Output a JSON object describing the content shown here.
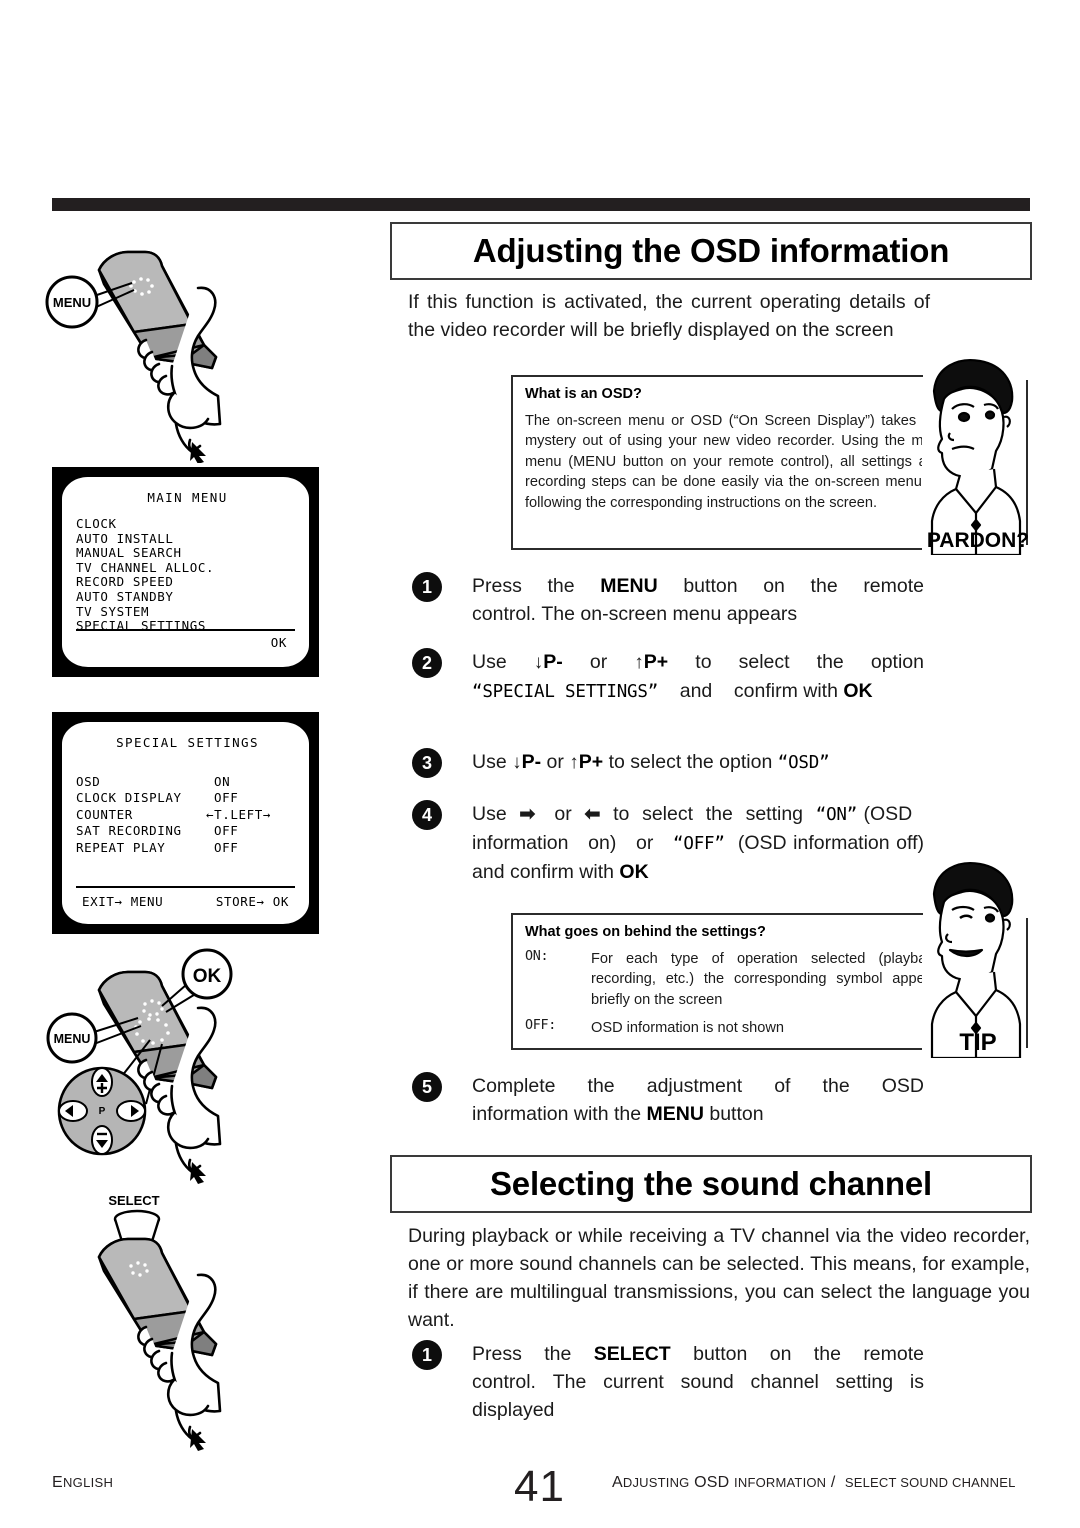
{
  "document": {
    "page_number": "41",
    "footer_left": "ENGLISH",
    "footer_right": "ADJUSTING OSD INFORMATION /  SELECT SOUND CHANNEL"
  },
  "sections": {
    "osd": {
      "title": "Adjusting the OSD information",
      "intro": "If this function is activated, the current operating details of the video recorder will be briefly displayed on the screen",
      "info_box": {
        "title": "What is an OSD?",
        "text": "The on-screen menu or OSD (“On Screen Display”) takes the mystery out of using your new video recorder. Using the main menu (MENU button on your remote control), all settings and recording steps can be done easily via the on-screen menu by following the corresponding instructions on the screen.",
        "badge": "PARDON?"
      },
      "steps": [
        {
          "num": "1",
          "parts": [
            {
              "t": "Press  the  ",
              "s": "n"
            },
            {
              "t": "MENU",
              "s": "b"
            },
            {
              "t": "  button  on  the  remote control. The on-screen menu appears",
              "s": "n"
            }
          ]
        },
        {
          "num": "2",
          "parts": [
            {
              "t": "Use  ",
              "s": "n"
            },
            {
              "t": "↓",
              "s": "arr"
            },
            {
              "t": "P-",
              "s": "b"
            },
            {
              "t": "  or  ",
              "s": "n"
            },
            {
              "t": "↑",
              "s": "arr"
            },
            {
              "t": "P+",
              "s": "b"
            },
            {
              "t": "  to  select  the  option ",
              "s": "n"
            },
            {
              "t": "“SPECIAL SETTINGS”",
              "s": "m"
            },
            {
              "t": "   and    confirm  with ",
              "s": "n"
            },
            {
              "t": "OK",
              "s": "b"
            }
          ]
        },
        {
          "num": "3",
          "parts": [
            {
              "t": "Use ",
              "s": "n"
            },
            {
              "t": "↓",
              "s": "arr"
            },
            {
              "t": "P-",
              "s": "b"
            },
            {
              "t": " or ",
              "s": "n"
            },
            {
              "t": "↑",
              "s": "arr"
            },
            {
              "t": "P+",
              "s": "b"
            },
            {
              "t": " to select the option ",
              "s": "n"
            },
            {
              "t": "“OSD”",
              "s": "m"
            }
          ]
        },
        {
          "num": "4",
          "parts": [
            {
              "t": "Use  ",
              "s": "n"
            },
            {
              "t": "➡",
              "s": "arr"
            },
            {
              "t": "   or  ",
              "s": "n"
            },
            {
              "t": "⬅",
              "s": "arr"
            },
            {
              "t": "  to  select  the  setting  ",
              "s": "n"
            },
            {
              "t": "“ON”",
              "s": "m"
            },
            {
              "t": " (OSD   information   on)   or   ",
              "s": "n"
            },
            {
              "t": "“OFF”",
              "s": "m"
            },
            {
              "t": "  (OSD information off) and confirm with ",
              "s": "n"
            },
            {
              "t": "OK",
              "s": "b"
            }
          ]
        },
        {
          "num": "5",
          "parts": [
            {
              "t": "Complete   the   adjustment   of   the   OSD information with the ",
              "s": "n"
            },
            {
              "t": "MENU",
              "s": "b"
            },
            {
              "t": " button",
              "s": "n"
            }
          ]
        }
      ],
      "tip_box": {
        "title": "What goes on behind the settings?",
        "rows": [
          {
            "term": "ON:",
            "desc": "For   each   type   of   operation   selected (playback, recording, etc.) the corresponding symbol appears briefly on the screen"
          },
          {
            "term": "OFF:",
            "desc": "OSD information is not shown"
          }
        ],
        "badge": "TIP"
      }
    },
    "sound": {
      "title": "Selecting the sound channel",
      "intro": "During playback or while receiving a TV channel via the video recorder, one or more sound channels can be selected. This means, for example, if there are multilingual transmissions, you can select the language you want.",
      "steps": [
        {
          "num": "1",
          "parts": [
            {
              "t": "Press  the  ",
              "s": "n"
            },
            {
              "t": "SELECT",
              "s": "b"
            },
            {
              "t": "  button  on  the  remote control. The current sound channel setting is displayed",
              "s": "n"
            }
          ]
        }
      ]
    }
  },
  "illustrations": {
    "remote_menu": {
      "callout": "MENU"
    },
    "remote_menu_ok": {
      "callout_ok": "OK",
      "callout_menu": "MENU",
      "pad_label": "P"
    },
    "remote_select": {
      "callout": "SELECT"
    }
  },
  "tv_screens": [
    {
      "name": "main-menu",
      "title": "MAIN MENU",
      "items": [
        "CLOCK",
        "AUTO INSTALL",
        "MANUAL SEARCH",
        "TV CHANNEL ALLOC.",
        "RECORD SPEED",
        "AUTO STANDBY",
        "TV SYSTEM",
        "SPECIAL SETTINGS"
      ],
      "footer_right": "OK"
    },
    {
      "name": "special-settings",
      "title": "SPECIAL SETTINGS",
      "rows": [
        {
          "label": "OSD",
          "value": "ON"
        },
        {
          "label": "CLOCK DISPLAY",
          "value": "OFF"
        },
        {
          "label": "COUNTER",
          "value": "←T.LEFT→"
        },
        {
          "label": "SAT RECORDING",
          "value": "OFF"
        },
        {
          "label": "REPEAT PLAY",
          "value": "OFF"
        }
      ],
      "footer_left": "EXIT→ MENU",
      "footer_right": "STORE→ OK"
    }
  ],
  "colors": {
    "rule": "#231f20",
    "remote_body": "#9a9a9a",
    "remote_top": "#b3b3b3",
    "remote_side": "#7d7d7d",
    "ink": "#1b1b1b"
  }
}
